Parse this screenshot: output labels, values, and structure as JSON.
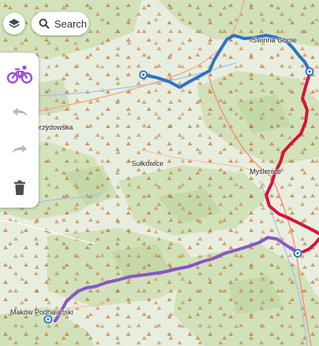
{
  "search": {
    "label": "Search"
  },
  "places": {
    "swinna": "Świnna Górne",
    "brzydowska": "orzydowska",
    "sulkowice": "Sułkowice",
    "myslenice": "Myślenice",
    "makow": "Maków Podhalański"
  },
  "toolbar": {
    "mode_icon": "bicycle-icon",
    "undo_icon": "undo-icon",
    "redo_icon": "redo-icon",
    "delete_icon": "trash-icon"
  },
  "map_layers_icon": "layers-icon",
  "colors": {
    "route_blue": "#2b73c4",
    "route_red": "#d8123c",
    "route_purple": "#8855c7",
    "accent_purple": "#9b4fd6",
    "terrain_green": "#d2e4be",
    "peak_orange": "#c77a3a"
  }
}
